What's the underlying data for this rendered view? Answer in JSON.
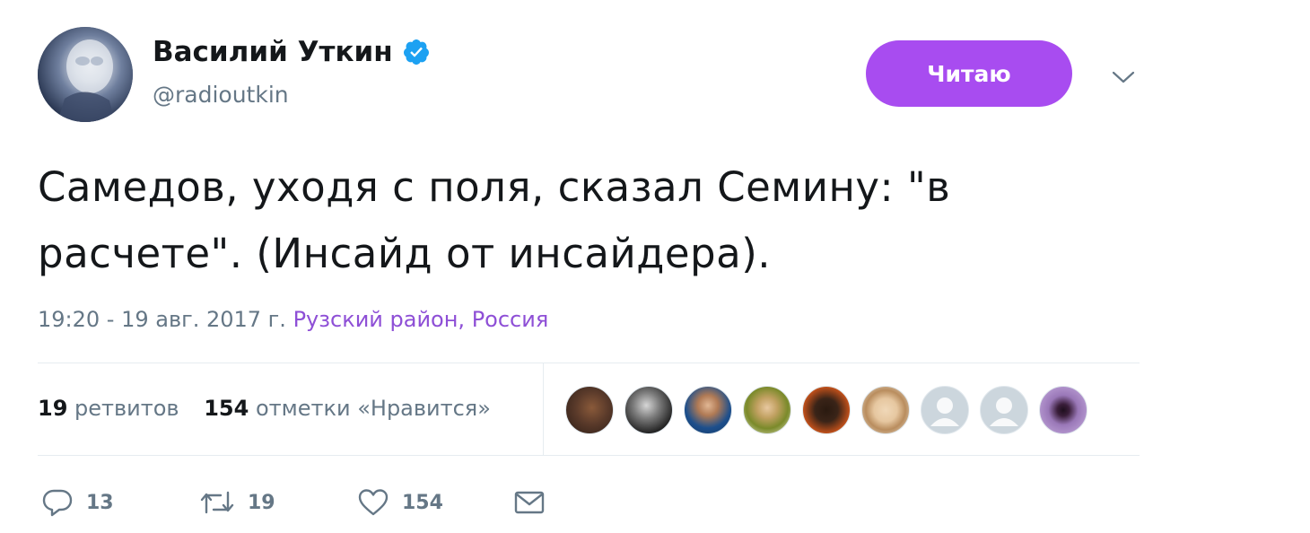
{
  "author": {
    "name": "Василий Уткин",
    "handle": "@radioutkin",
    "verified": true,
    "verified_color": "#1da1f2"
  },
  "follow_button": {
    "label": "Читаю",
    "color": "#a84cf0"
  },
  "tweet": {
    "text": "Самедов, уходя с поля, сказал Семину: \"в расчете\". (Инсайд от инсайдера).",
    "timestamp": "19:20 - 19 авг. 2017 г.",
    "place": "Рузский район, Россия",
    "place_color": "#8e4fd6"
  },
  "stats": {
    "retweets_count": "19",
    "retweets_label": "ретвитов",
    "likes_count": "154",
    "likes_label": "отметки «Нравится»"
  },
  "likers": [
    {
      "name": "liker-1",
      "colors": [
        "#3a2a22",
        "#8a5a3a"
      ]
    },
    {
      "name": "liker-2",
      "colors": [
        "#1a1a1a",
        "#bdbdbd"
      ]
    },
    {
      "name": "liker-3",
      "colors": [
        "#1b4f8a",
        "#d9b08c"
      ]
    },
    {
      "name": "liker-4",
      "colors": [
        "#cfcfa0",
        "#6b7a2a"
      ]
    },
    {
      "name": "liker-5",
      "colors": [
        "#c0501a",
        "#2a1a10"
      ]
    },
    {
      "name": "liker-6",
      "colors": [
        "#e9e3d8",
        "#b98d5e"
      ]
    },
    {
      "name": "liker-7",
      "default": true
    },
    {
      "name": "liker-8",
      "default": true
    },
    {
      "name": "liker-9",
      "colors": [
        "#b79ad0",
        "#3a1e3a"
      ]
    }
  ],
  "actions": {
    "reply_count": "13",
    "retweet_count": "19",
    "like_count": "154",
    "icons": [
      "reply-icon",
      "retweet-icon",
      "like-icon",
      "direct-message-icon"
    ]
  }
}
